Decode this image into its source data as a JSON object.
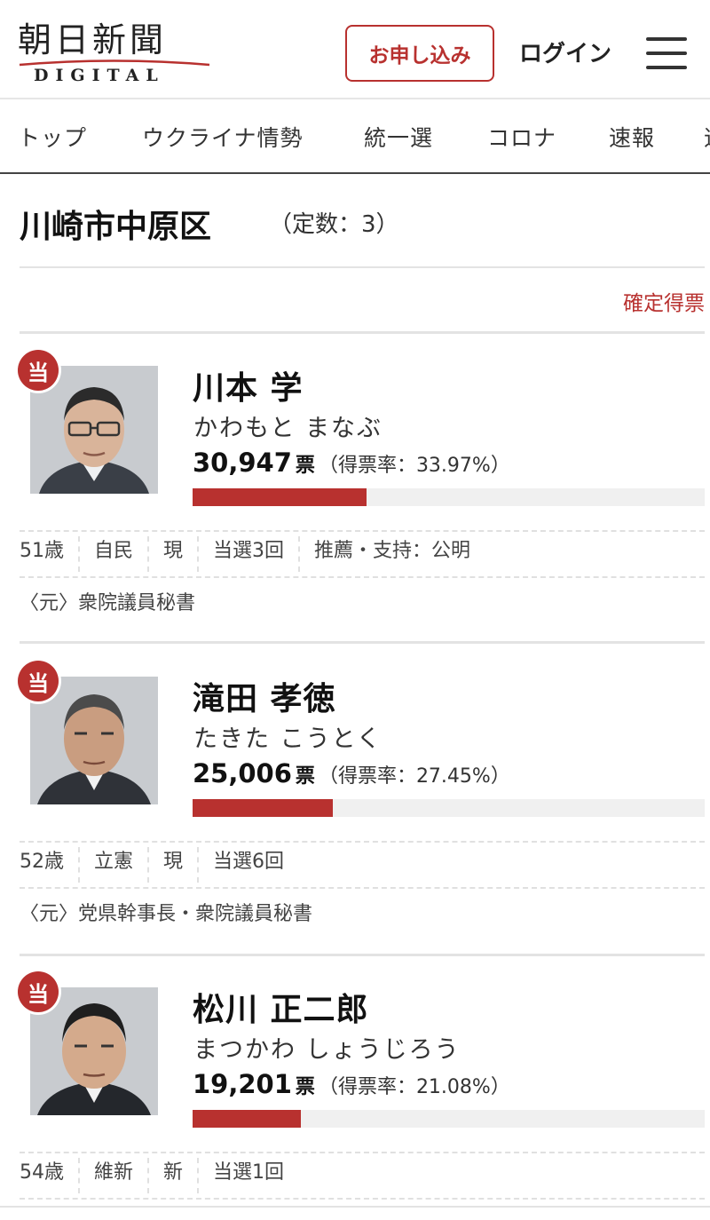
{
  "header": {
    "logo_main": "朝日新聞",
    "logo_sub": "DIGITAL",
    "apply_button": "お申し込み",
    "login_button": "ログイン"
  },
  "nav": [
    "トップ",
    "ウクライナ情勢",
    "統一選",
    "コロナ",
    "速報",
    "速"
  ],
  "page": {
    "title": "川崎市中原区",
    "seat_count": "（定数：3）",
    "final_label": "確定得票"
  },
  "colors": {
    "accent": "#b8312f",
    "bar_track": "#f0f0f0"
  },
  "candidates": [
    {
      "elected_badge": "当",
      "name": "川本  学",
      "kana": "かわもと  まなぶ",
      "votes": "30,947",
      "votes_unit": "票",
      "rate": "（得票率：33.97%）",
      "rate_value": 0.3397,
      "age": "51歳",
      "party": "自民",
      "status": "現",
      "times": "当選3回",
      "endorse": "推薦・支持：公明",
      "career": "〈元〉衆院議員秘書"
    },
    {
      "elected_badge": "当",
      "name": "滝田  孝徳",
      "kana": "たきた  こうとく",
      "votes": "25,006",
      "votes_unit": "票",
      "rate": "（得票率：27.45%）",
      "rate_value": 0.2745,
      "age": "52歳",
      "party": "立憲",
      "status": "現",
      "times": "当選6回",
      "endorse": "",
      "career": "〈元〉党県幹事長・衆院議員秘書"
    },
    {
      "elected_badge": "当",
      "name": "松川  正二郎",
      "kana": "まつかわ  しょうじろう",
      "votes": "19,201",
      "votes_unit": "票",
      "rate": "（得票率：21.08%）",
      "rate_value": 0.2108,
      "age": "54歳",
      "party": "維新",
      "status": "新",
      "times": "当選1回",
      "endorse": "",
      "career": ""
    }
  ]
}
